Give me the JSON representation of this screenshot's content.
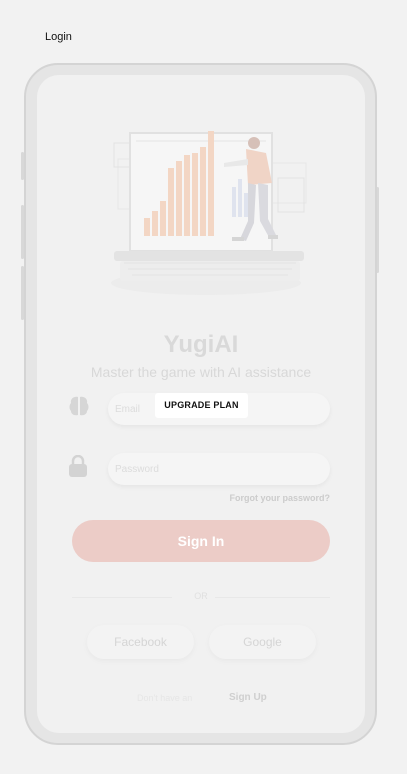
{
  "page": {
    "label": "Login"
  },
  "app": {
    "title": "YugiAI",
    "subtitle": "Master the game with AI assistance"
  },
  "form": {
    "email_placeholder": "Email",
    "password_placeholder": "Password",
    "forgot_label": "Forgot your password?",
    "signin_label": "Sign In",
    "or_label": "OR"
  },
  "upgrade": {
    "label": "UPGRADE PLAN"
  },
  "social": {
    "facebook_label": "Facebook",
    "google_label": "Google"
  },
  "footer": {
    "no_account_label": "Don't have an",
    "signup_label": "Sign Up"
  },
  "icons": {
    "field1": "brain-icon",
    "field2": "lock-icon"
  },
  "colors": {
    "accent": "#ecccc7",
    "background": "#f2f2f2"
  }
}
